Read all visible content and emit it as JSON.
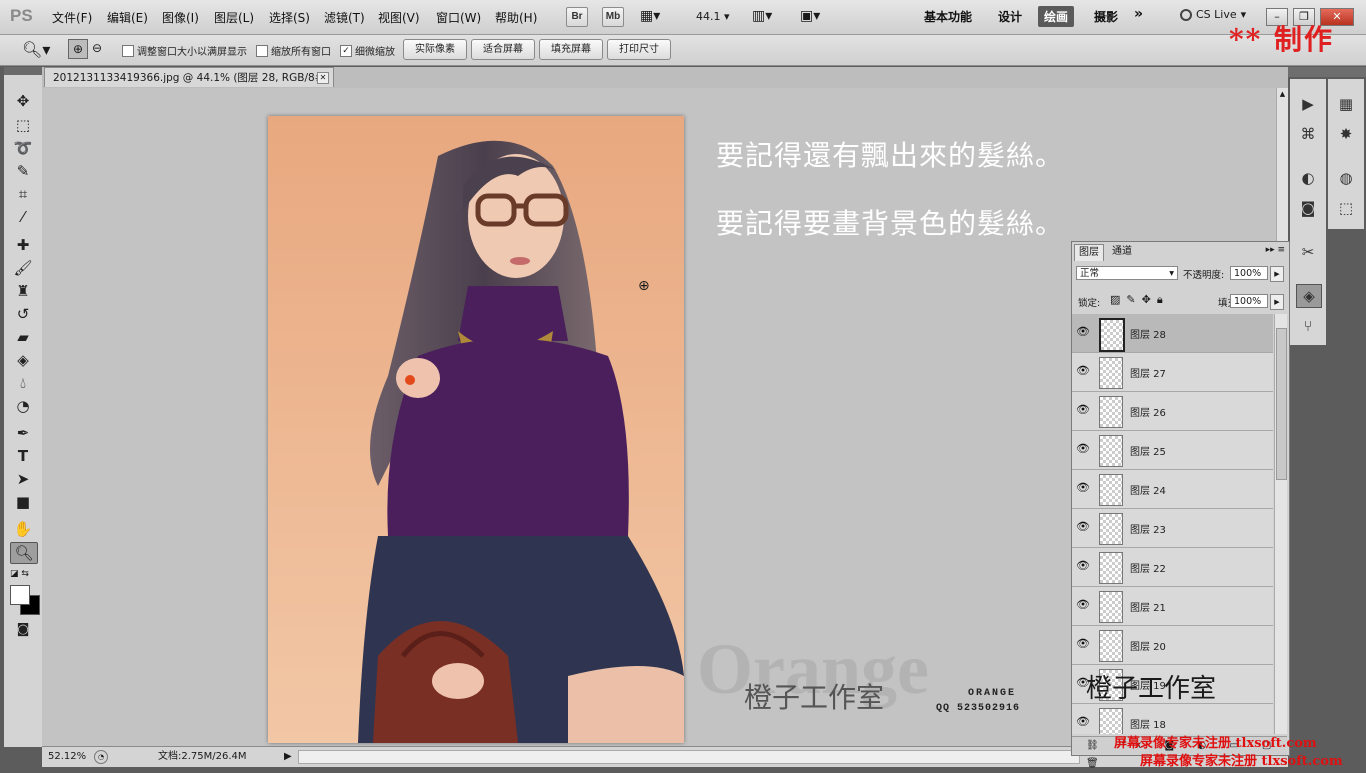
{
  "menubar": {
    "logo": "PS",
    "items": [
      "文件(F)",
      "编辑(E)",
      "图像(I)",
      "图层(L)",
      "选择(S)",
      "滤镜(T)",
      "视图(V)",
      "窗口(W)",
      "帮助(H)"
    ],
    "bridge": "Br",
    "minibridge": "Mb",
    "zoom": "44.1",
    "workspaces": [
      "基本功能",
      "设计",
      "绘画",
      "摄影"
    ],
    "active_workspace": "绘画",
    "more": "»",
    "cslive": "CS Live"
  },
  "options": {
    "checks": [
      {
        "label": "调整窗口大小以满屏显示",
        "checked": false
      },
      {
        "label": "缩放所有窗口",
        "checked": false
      },
      {
        "label": "细微缩放",
        "checked": true
      }
    ],
    "buttons": [
      "实际像素",
      "适合屏幕",
      "填充屏幕",
      "打印尺寸"
    ]
  },
  "watermark_top": "** 制作",
  "document": {
    "tab_title": "2012131133419366.jpg @ 44.1% (图层 28, RGB/8#) *",
    "caption_lines": [
      "要記得還有飄出來的髮絲。",
      "要記得要畫背景色的髮絲。"
    ],
    "studio_overlay": {
      "main": "橙子工作室",
      "sub": "ORANGE",
      "qq": "QQ 523502916",
      "bg_word": "Orange"
    }
  },
  "status": {
    "zoom": "52.12%",
    "doc_info": "文档:2.75M/26.4M"
  },
  "layers_panel": {
    "tabs": [
      "图层",
      "通道"
    ],
    "blend_mode": "正常",
    "opacity_label": "不透明度:",
    "opacity": "100%",
    "lock_label": "锁定:",
    "fill_label": "填充:",
    "fill": "100%",
    "layers": [
      "图层 28",
      "图层 27",
      "图层 26",
      "图层 25",
      "图层 24",
      "图层 23",
      "图层 22",
      "图层 21",
      "图层 20",
      "图层 19",
      "图层 18"
    ],
    "selected": "图层 28"
  },
  "watermarks_bottom": [
    "屏幕录像专家未注册 tlxsoft.com",
    "屏幕录像专家未注册 tlxsoft.com"
  ]
}
